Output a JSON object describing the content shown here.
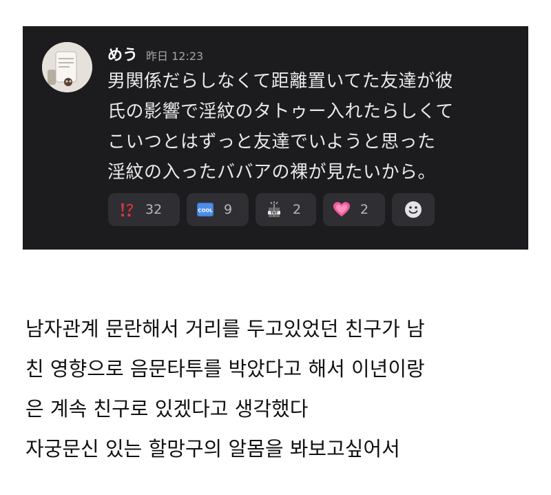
{
  "post": {
    "username": "めう",
    "timestamp": "昨日 12:23",
    "message_lines": [
      "男関係だらしなくて距離置いてた友達が彼",
      "氏の影響で淫紋のタトゥー入れたらしくて",
      "こいつとはずっと友達でいようと思った",
      "淫紋の入ったババアの裸が見たいから。"
    ],
    "reactions": [
      {
        "icon": "interrobang-icon",
        "count": "32"
      },
      {
        "icon": "cool-icon",
        "count": "9"
      },
      {
        "icon": "tnt-icon",
        "count": "2"
      },
      {
        "icon": "growing-heart-icon",
        "count": "2"
      }
    ],
    "add_reaction_icon": "smiley-add-reaction-icon"
  },
  "translation": {
    "lines": [
      "남자관계 문란해서 거리를 두고있었던 친구가 남",
      "친 영향으로 음문타투를 박았다고 해서 이년이랑",
      "은 계속 친구로 있겠다고 생각했다",
      "자궁문신 있는 할망구의 알몸을 봐보고싶어서"
    ]
  },
  "colors": {
    "card_background": "#1c1c1f",
    "reaction_background": "#2e2e33",
    "text_light": "#e9e9ec",
    "text_muted": "#a6a6ac",
    "text_dark": "#111111"
  }
}
